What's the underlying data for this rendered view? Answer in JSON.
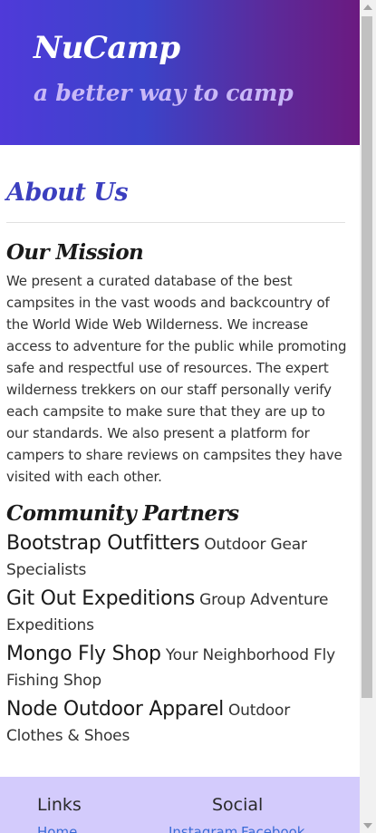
{
  "header": {
    "brand": "NuCamp",
    "tagline": "a better way to camp"
  },
  "about": {
    "title": "About Us"
  },
  "mission": {
    "title": "Our Mission",
    "text": "We present a curated database of the best campsites in the vast woods and backcountry of the World Wide Web Wilderness. We increase access to adventure for the public while promoting safe and respectful use of resources. The expert wilderness trekkers on our staff personally verify each campsite to make sure that they are up to our standards. We also present a platform for campers to share reviews on campsites they have visited with each other."
  },
  "partners": {
    "title": "Community Partners",
    "items": [
      {
        "name": "Bootstrap Outfitters",
        "desc": "Outdoor Gear Specialists"
      },
      {
        "name": "Git Out Expeditions",
        "desc": "Group Adventure Expeditions"
      },
      {
        "name": "Mongo Fly Shop",
        "desc": "Your Neighborhood Fly Fishing Shop"
      },
      {
        "name": "Node Outdoor Apparel",
        "desc": "Outdoor Clothes & Shoes"
      }
    ]
  },
  "footer": {
    "links_heading": "Links",
    "social_heading": "Social",
    "home_link": "Home",
    "instagram_link": "Instagram",
    "facebook_link": "Facebook"
  }
}
